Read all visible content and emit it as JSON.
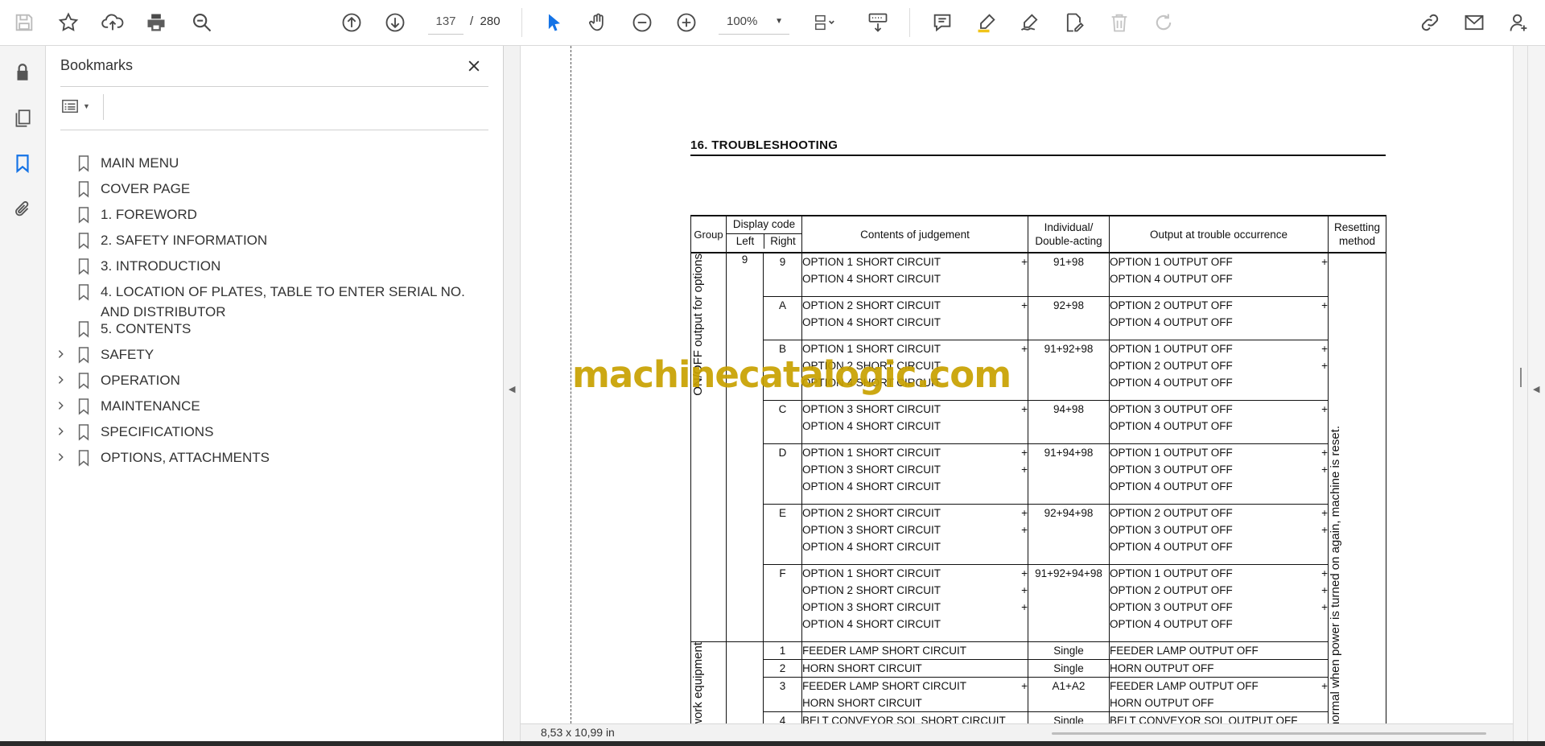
{
  "toolbar": {
    "page_current": "137",
    "page_separator": "/",
    "page_total": "280",
    "zoom": "100%"
  },
  "bookmarks_panel": {
    "title": "Bookmarks",
    "items": [
      {
        "label": "MAIN MENU",
        "expandable": false
      },
      {
        "label": "COVER PAGE",
        "expandable": false
      },
      {
        "label": "1.  FOREWORD",
        "expandable": false
      },
      {
        "label": "2.  SAFETY INFORMATION",
        "expandable": false
      },
      {
        "label": "3.  INTRODUCTION",
        "expandable": false
      },
      {
        "label": "4.  LOCATION OF PLATES, TABLE TO ENTER SERIAL NO. AND DISTRIBUTOR",
        "expandable": false
      },
      {
        "label": "5.  CONTENTS",
        "expandable": false
      },
      {
        "label": "SAFETY",
        "expandable": true
      },
      {
        "label": "OPERATION",
        "expandable": true
      },
      {
        "label": "MAINTENANCE",
        "expandable": true
      },
      {
        "label": "SPECIFICATIONS",
        "expandable": true
      },
      {
        "label": "OPTIONS, ATTACHMENTS",
        "expandable": true
      }
    ]
  },
  "document": {
    "heading": "16.  TROUBLESHOOTING",
    "watermark": "machinecatalogic.com",
    "table": {
      "headers": {
        "group": "Group",
        "display_code": "Display code",
        "left": "Left",
        "right": "Right",
        "contents": "Contents of judgement",
        "individual": "Individual/ Double-acting",
        "output": "Output at trouble occurrence",
        "resetting": "Resetting method"
      },
      "group1_label": "ON/OFF output for options",
      "group1_left_code": "9",
      "group2_label": "work equipment",
      "resetting_text": "normal when power is turned on again, machine is reset.",
      "rows": [
        {
          "code": "9",
          "contents": [
            "OPTION 1 SHORT CIRCUIT",
            "OPTION 4 SHORT CIRCUIT"
          ],
          "contents_plus": [
            "+",
            ""
          ],
          "individual": "91+98",
          "output": [
            "OPTION 1 OUTPUT OFF",
            "OPTION 4 OUTPUT OFF"
          ],
          "output_plus": [
            "+",
            ""
          ]
        },
        {
          "code": "A",
          "contents": [
            "OPTION 2 SHORT CIRCUIT",
            "OPTION 4 SHORT CIRCUIT"
          ],
          "contents_plus": [
            "+",
            ""
          ],
          "individual": "92+98",
          "output": [
            "OPTION 2 OUTPUT OFF",
            "OPTION 4 OUTPUT OFF"
          ],
          "output_plus": [
            "+",
            ""
          ]
        },
        {
          "code": "B",
          "contents": [
            "OPTION 1 SHORT CIRCUIT",
            "OPTION 2 SHORT CIRCUIT",
            "OPTION 4 SHORT CIRCUIT"
          ],
          "contents_plus": [
            "+",
            "",
            ""
          ],
          "individual": "91+92+98",
          "output": [
            "OPTION 1 OUTPUT OFF",
            "OPTION 2 OUTPUT OFF",
            "OPTION 4 OUTPUT OFF"
          ],
          "output_plus": [
            "+",
            "+",
            ""
          ]
        },
        {
          "code": "C",
          "contents": [
            "OPTION 3 SHORT CIRCUIT",
            "OPTION 4 SHORT CIRCUIT"
          ],
          "contents_plus": [
            "+",
            ""
          ],
          "individual": "94+98",
          "output": [
            "OPTION 3 OUTPUT OFF",
            "OPTION 4 OUTPUT OFF"
          ],
          "output_plus": [
            "+",
            ""
          ]
        },
        {
          "code": "D",
          "contents": [
            "OPTION 1 SHORT CIRCUIT",
            "OPTION 3 SHORT CIRCUIT",
            "OPTION 4 SHORT CIRCUIT"
          ],
          "contents_plus": [
            "+",
            "+",
            ""
          ],
          "individual": "91+94+98",
          "output": [
            "OPTION 1 OUTPUT OFF",
            "OPTION 3 OUTPUT OFF",
            "OPTION 4 OUTPUT OFF"
          ],
          "output_plus": [
            "+",
            "+",
            ""
          ]
        },
        {
          "code": "E",
          "contents": [
            "OPTION 2 SHORT CIRCUIT",
            "OPTION 3 SHORT CIRCUIT",
            "OPTION 4 SHORT CIRCUIT"
          ],
          "contents_plus": [
            "+",
            "+",
            ""
          ],
          "individual": "92+94+98",
          "output": [
            "OPTION 2 OUTPUT OFF",
            "OPTION 3 OUTPUT OFF",
            "OPTION 4 OUTPUT OFF"
          ],
          "output_plus": [
            "+",
            "+",
            ""
          ]
        },
        {
          "code": "F",
          "contents": [
            "OPTION 1 SHORT CIRCUIT",
            "OPTION 2 SHORT CIRCUIT",
            "OPTION 3 SHORT CIRCUIT",
            "OPTION 4 SHORT CIRCUIT"
          ],
          "contents_plus": [
            "+",
            "+",
            "+",
            ""
          ],
          "individual": "91+92+94+98",
          "output": [
            "OPTION 1 OUTPUT OFF",
            "OPTION 2 OUTPUT OFF",
            "OPTION 3 OUTPUT OFF",
            "OPTION 4 OUTPUT OFF"
          ],
          "output_plus": [
            "+",
            "+",
            "+",
            ""
          ]
        },
        {
          "code": "1",
          "contents": [
            "FEEDER LAMP SHORT CIRCUIT"
          ],
          "contents_plus": [
            ""
          ],
          "individual": "Single",
          "output": [
            "FEEDER LAMP OUTPUT OFF"
          ],
          "output_plus": [
            ""
          ]
        },
        {
          "code": "2",
          "contents": [
            "HORN SHORT CIRCUIT"
          ],
          "contents_plus": [
            ""
          ],
          "individual": "Single",
          "output": [
            "HORN OUTPUT OFF"
          ],
          "output_plus": [
            ""
          ]
        },
        {
          "code": "3",
          "contents": [
            "FEEDER LAMP SHORT CIRCUIT",
            "HORN SHORT CIRCUIT"
          ],
          "contents_plus": [
            "+",
            ""
          ],
          "individual": "A1+A2",
          "output": [
            "FEEDER LAMP OUTPUT OFF",
            "HORN OUTPUT OFF"
          ],
          "output_plus": [
            "+",
            ""
          ]
        },
        {
          "code": "4",
          "contents": [
            "BELT CONVEYOR SOL SHORT CIRCUIT"
          ],
          "contents_plus": [
            ""
          ],
          "individual": "Single",
          "output": [
            "BELT CONVEYOR SOL OUTPUT OFF"
          ],
          "output_plus": [
            ""
          ]
        }
      ]
    }
  },
  "status": {
    "page_size": "8,53 x 10,99 in"
  },
  "colors": {
    "accent_blue": "#1473e6",
    "watermark": "#c8a100"
  }
}
